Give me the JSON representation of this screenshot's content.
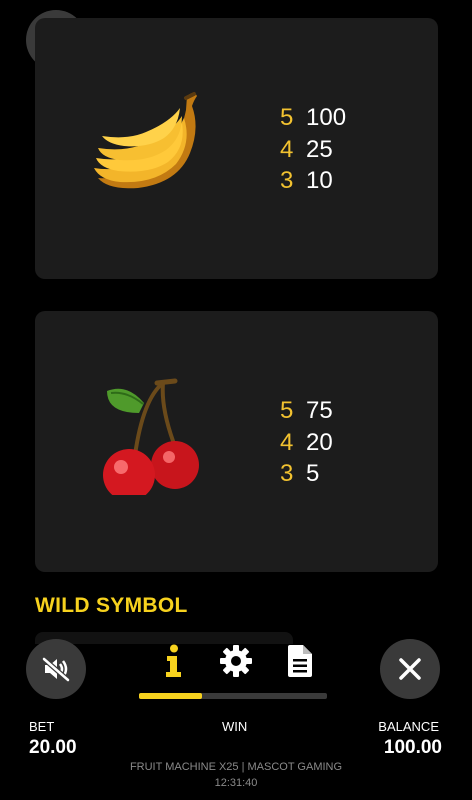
{
  "paytable": [
    {
      "symbol": "banana-symbol",
      "rows": [
        {
          "count": "5",
          "value": "100"
        },
        {
          "count": "4",
          "value": "25"
        },
        {
          "count": "3",
          "value": "10"
        }
      ]
    },
    {
      "symbol": "cherry-symbol",
      "rows": [
        {
          "count": "5",
          "value": "75"
        },
        {
          "count": "4",
          "value": "20"
        },
        {
          "count": "3",
          "value": "5"
        }
      ]
    }
  ],
  "section_title": "WILD SYMBOL",
  "tabs": [
    {
      "icon": "info-icon",
      "active": true
    },
    {
      "icon": "gear-icon",
      "active": false
    },
    {
      "icon": "document-icon",
      "active": false
    }
  ],
  "controls": {
    "home_icon": "home-icon",
    "sound_icon": "sound-muted-icon",
    "close_icon": "close-icon"
  },
  "bet": {
    "label": "BET",
    "value": "20.00"
  },
  "win": {
    "label": "WIN"
  },
  "balance": {
    "label": "BALANCE",
    "value": "100.00"
  },
  "footer": {
    "title": "FRUIT MACHINE X25 | MASCOT GAMING",
    "time": "12:31:40"
  },
  "colors": {
    "accent": "#f7d21e",
    "count": "#f2c230",
    "card": "#1c1c1c",
    "button": "#3a3a3a"
  }
}
